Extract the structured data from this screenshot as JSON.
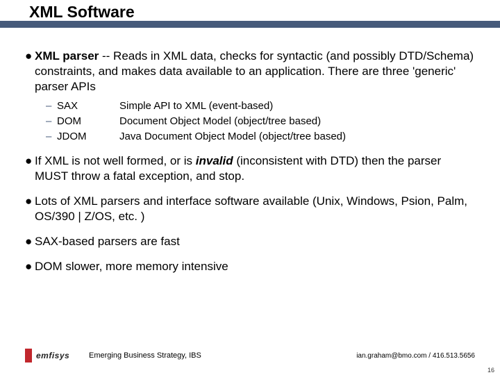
{
  "title": "XML Software",
  "bullets": [
    {
      "lead_bold": "XML parser",
      "rest": " -- Reads in XML data, checks for syntactic (and possibly DTD/Schema) constraints, and makes data  available to an application.  There are three 'generic' parser APIs"
    },
    {
      "pre": "If XML is not well formed, or is ",
      "ital": "invalid",
      "post": " (inconsistent with DTD) then the parser  MUST throw a fatal exception, and stop."
    },
    {
      "plain": "Lots of XML parsers and interface software available (Unix, Windows, Psion, Palm, OS/390 | Z/OS, etc. )"
    },
    {
      "plain": "SAX-based parsers are fast"
    },
    {
      "plain": "DOM slower, more memory intensive"
    }
  ],
  "apis": [
    {
      "name": "SAX",
      "desc": "Simple API to XML (event-based)"
    },
    {
      "name": "DOM",
      "desc": "Document Object Model (object/tree based)"
    },
    {
      "name": "JDOM",
      "desc": "Java Document Object Model  (object/tree based)"
    }
  ],
  "footer": {
    "logo_text": "emfisys",
    "center": "Emerging Business Strategy, IBS",
    "right": "ian.graham@bmo.com / 416.513.5656"
  },
  "page_number": "16"
}
